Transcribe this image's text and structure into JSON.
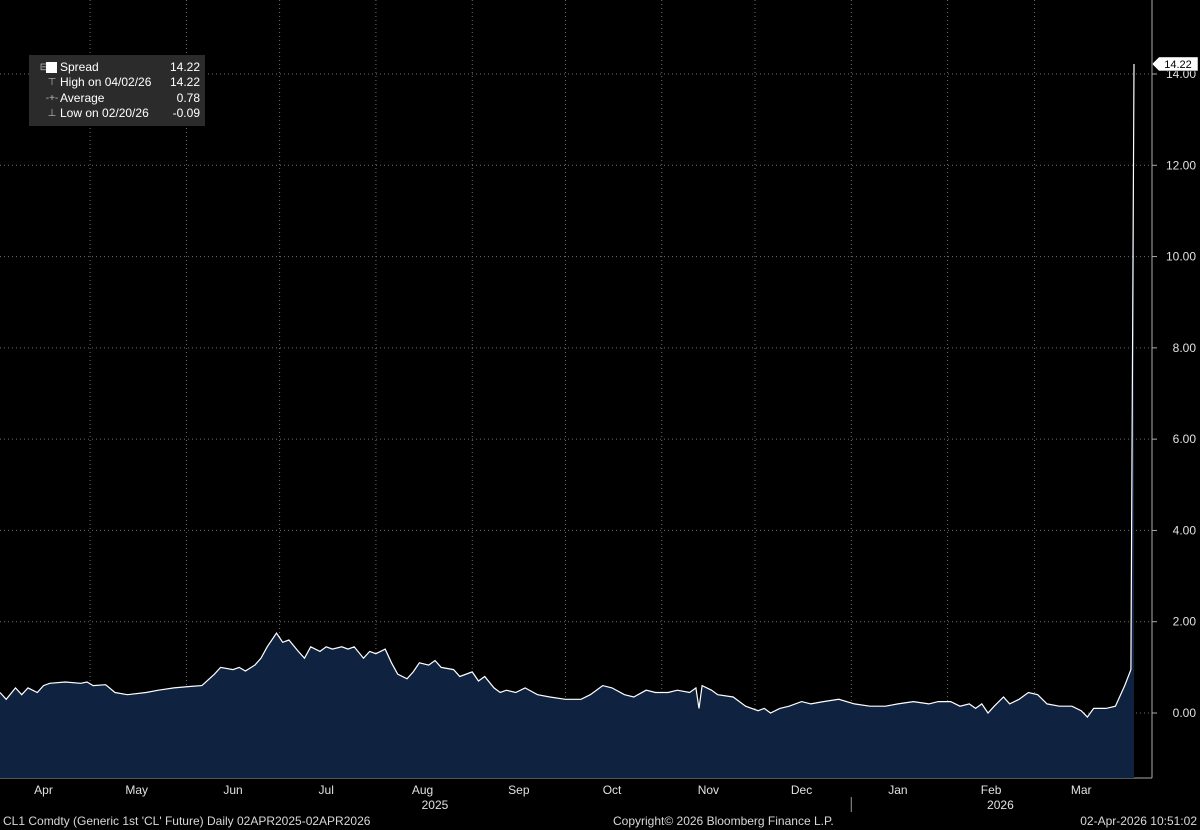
{
  "legend": {
    "spread_label": "Spread",
    "spread_value": "14.22",
    "high_label": "High on 04/02/26",
    "high_value": "14.22",
    "average_label": "Average",
    "average_value": "0.78",
    "low_label": "Low on 02/20/26",
    "low_value": "-0.09"
  },
  "last_value_tag": "14.22",
  "footer": {
    "left": "CL1 Comdty (Generic 1st 'CL' Future) Daily 02APR2025-02APR2026",
    "center": "Copyright© 2026 Bloomberg Finance L.P.",
    "right": "02-Apr-2026 10:51:02"
  },
  "colors": {
    "background": "#000000",
    "area_fill": "#0f2340",
    "line": "#ffffff",
    "grid": "#6e6e6e",
    "legend_bg": "#2b2b2b"
  },
  "chart_data": {
    "type": "area",
    "title": "",
    "xlabel": "",
    "ylabel": "",
    "x_range": [
      "2025-04-02",
      "2026-04-02"
    ],
    "ylim": [
      -1.2,
      15.7
    ],
    "y_ticks": [
      "0.00",
      "2.00",
      "4.00",
      "6.00",
      "8.00",
      "10.00",
      "12.00",
      "14.00"
    ],
    "x_ticks": [
      "Apr",
      "May",
      "Jun",
      "Jul",
      "Aug",
      "Sep",
      "Oct",
      "Nov",
      "Dec",
      "Jan",
      "Feb",
      "Mar"
    ],
    "year_labels": [
      "2025",
      "2026"
    ],
    "grid": true,
    "legend_position": "top-left",
    "series": [
      {
        "name": "Spread",
        "points": [
          [
            "2025-04-02",
            0.45
          ],
          [
            "2025-04-04",
            0.3
          ],
          [
            "2025-04-07",
            0.55
          ],
          [
            "2025-04-09",
            0.4
          ],
          [
            "2025-04-11",
            0.55
          ],
          [
            "2025-04-14",
            0.45
          ],
          [
            "2025-04-16",
            0.6
          ],
          [
            "2025-04-18",
            0.65
          ],
          [
            "2025-04-23",
            0.68
          ],
          [
            "2025-04-28",
            0.65
          ],
          [
            "2025-04-30",
            0.68
          ],
          [
            "2025-05-02",
            0.6
          ],
          [
            "2025-05-06",
            0.62
          ],
          [
            "2025-05-09",
            0.45
          ],
          [
            "2025-05-13",
            0.4
          ],
          [
            "2025-05-19",
            0.45
          ],
          [
            "2025-05-23",
            0.5
          ],
          [
            "2025-05-28",
            0.55
          ],
          [
            "2025-06-02",
            0.58
          ],
          [
            "2025-06-06",
            0.6
          ],
          [
            "2025-06-10",
            0.85
          ],
          [
            "2025-06-12",
            1.0
          ],
          [
            "2025-06-16",
            0.95
          ],
          [
            "2025-06-18",
            1.0
          ],
          [
            "2025-06-20",
            0.92
          ],
          [
            "2025-06-23",
            1.05
          ],
          [
            "2025-06-25",
            1.2
          ],
          [
            "2025-06-27",
            1.45
          ],
          [
            "2025-06-30",
            1.75
          ],
          [
            "2025-07-02",
            1.55
          ],
          [
            "2025-07-04",
            1.6
          ],
          [
            "2025-07-07",
            1.35
          ],
          [
            "2025-07-09",
            1.2
          ],
          [
            "2025-07-11",
            1.45
          ],
          [
            "2025-07-14",
            1.35
          ],
          [
            "2025-07-16",
            1.45
          ],
          [
            "2025-07-18",
            1.4
          ],
          [
            "2025-07-21",
            1.45
          ],
          [
            "2025-07-23",
            1.4
          ],
          [
            "2025-07-25",
            1.45
          ],
          [
            "2025-07-28",
            1.2
          ],
          [
            "2025-07-30",
            1.35
          ],
          [
            "2025-08-01",
            1.3
          ],
          [
            "2025-08-04",
            1.4
          ],
          [
            "2025-08-06",
            1.1
          ],
          [
            "2025-08-08",
            0.85
          ],
          [
            "2025-08-11",
            0.75
          ],
          [
            "2025-08-13",
            0.9
          ],
          [
            "2025-08-15",
            1.1
          ],
          [
            "2025-08-18",
            1.05
          ],
          [
            "2025-08-20",
            1.15
          ],
          [
            "2025-08-22",
            1.0
          ],
          [
            "2025-08-26",
            0.95
          ],
          [
            "2025-08-28",
            0.8
          ],
          [
            "2025-09-01",
            0.9
          ],
          [
            "2025-09-03",
            0.7
          ],
          [
            "2025-09-05",
            0.8
          ],
          [
            "2025-09-08",
            0.55
          ],
          [
            "2025-09-10",
            0.45
          ],
          [
            "2025-09-12",
            0.5
          ],
          [
            "2025-09-15",
            0.45
          ],
          [
            "2025-09-18",
            0.55
          ],
          [
            "2025-09-22",
            0.4
          ],
          [
            "2025-09-26",
            0.35
          ],
          [
            "2025-10-01",
            0.3
          ],
          [
            "2025-10-06",
            0.3
          ],
          [
            "2025-10-09",
            0.4
          ],
          [
            "2025-10-13",
            0.6
          ],
          [
            "2025-10-16",
            0.55
          ],
          [
            "2025-10-20",
            0.4
          ],
          [
            "2025-10-23",
            0.35
          ],
          [
            "2025-10-27",
            0.5
          ],
          [
            "2025-10-30",
            0.45
          ],
          [
            "2025-11-03",
            0.45
          ],
          [
            "2025-11-06",
            0.5
          ],
          [
            "2025-11-10",
            0.45
          ],
          [
            "2025-11-12",
            0.55
          ],
          [
            "2025-11-13",
            0.1
          ],
          [
            "2025-11-14",
            0.6
          ],
          [
            "2025-11-17",
            0.5
          ],
          [
            "2025-11-19",
            0.4
          ],
          [
            "2025-11-24",
            0.35
          ],
          [
            "2025-11-28",
            0.15
          ],
          [
            "2025-12-02",
            0.05
          ],
          [
            "2025-12-04",
            0.1
          ],
          [
            "2025-12-06",
            0.0
          ],
          [
            "2025-12-09",
            0.1
          ],
          [
            "2025-12-12",
            0.15
          ],
          [
            "2025-12-16",
            0.25
          ],
          [
            "2025-12-19",
            0.2
          ],
          [
            "2025-12-23",
            0.25
          ],
          [
            "2025-12-28",
            0.3
          ],
          [
            "2026-01-02",
            0.2
          ],
          [
            "2026-01-07",
            0.15
          ],
          [
            "2026-01-12",
            0.15
          ],
          [
            "2026-01-16",
            0.2
          ],
          [
            "2026-01-21",
            0.25
          ],
          [
            "2026-01-26",
            0.2
          ],
          [
            "2026-01-29",
            0.25
          ],
          [
            "2026-02-02",
            0.25
          ],
          [
            "2026-02-05",
            0.15
          ],
          [
            "2026-02-08",
            0.2
          ],
          [
            "2026-02-10",
            0.1
          ],
          [
            "2026-02-12",
            0.2
          ],
          [
            "2026-02-14",
            0.0
          ],
          [
            "2026-02-16",
            0.15
          ],
          [
            "2026-02-19",
            0.35
          ],
          [
            "2026-02-21",
            0.2
          ],
          [
            "2026-02-24",
            0.3
          ],
          [
            "2026-02-27",
            0.45
          ],
          [
            "2026-03-02",
            0.4
          ],
          [
            "2026-03-05",
            0.2
          ],
          [
            "2026-03-09",
            0.15
          ],
          [
            "2026-03-13",
            0.15
          ],
          [
            "2026-03-16",
            0.05
          ],
          [
            "2026-03-18",
            -0.09
          ],
          [
            "2026-03-20",
            0.1
          ],
          [
            "2026-03-24",
            0.1
          ],
          [
            "2026-03-27",
            0.15
          ],
          [
            "2026-03-30",
            0.6
          ],
          [
            "2026-04-01",
            0.95
          ],
          [
            "2026-04-02",
            14.22
          ]
        ]
      }
    ]
  }
}
